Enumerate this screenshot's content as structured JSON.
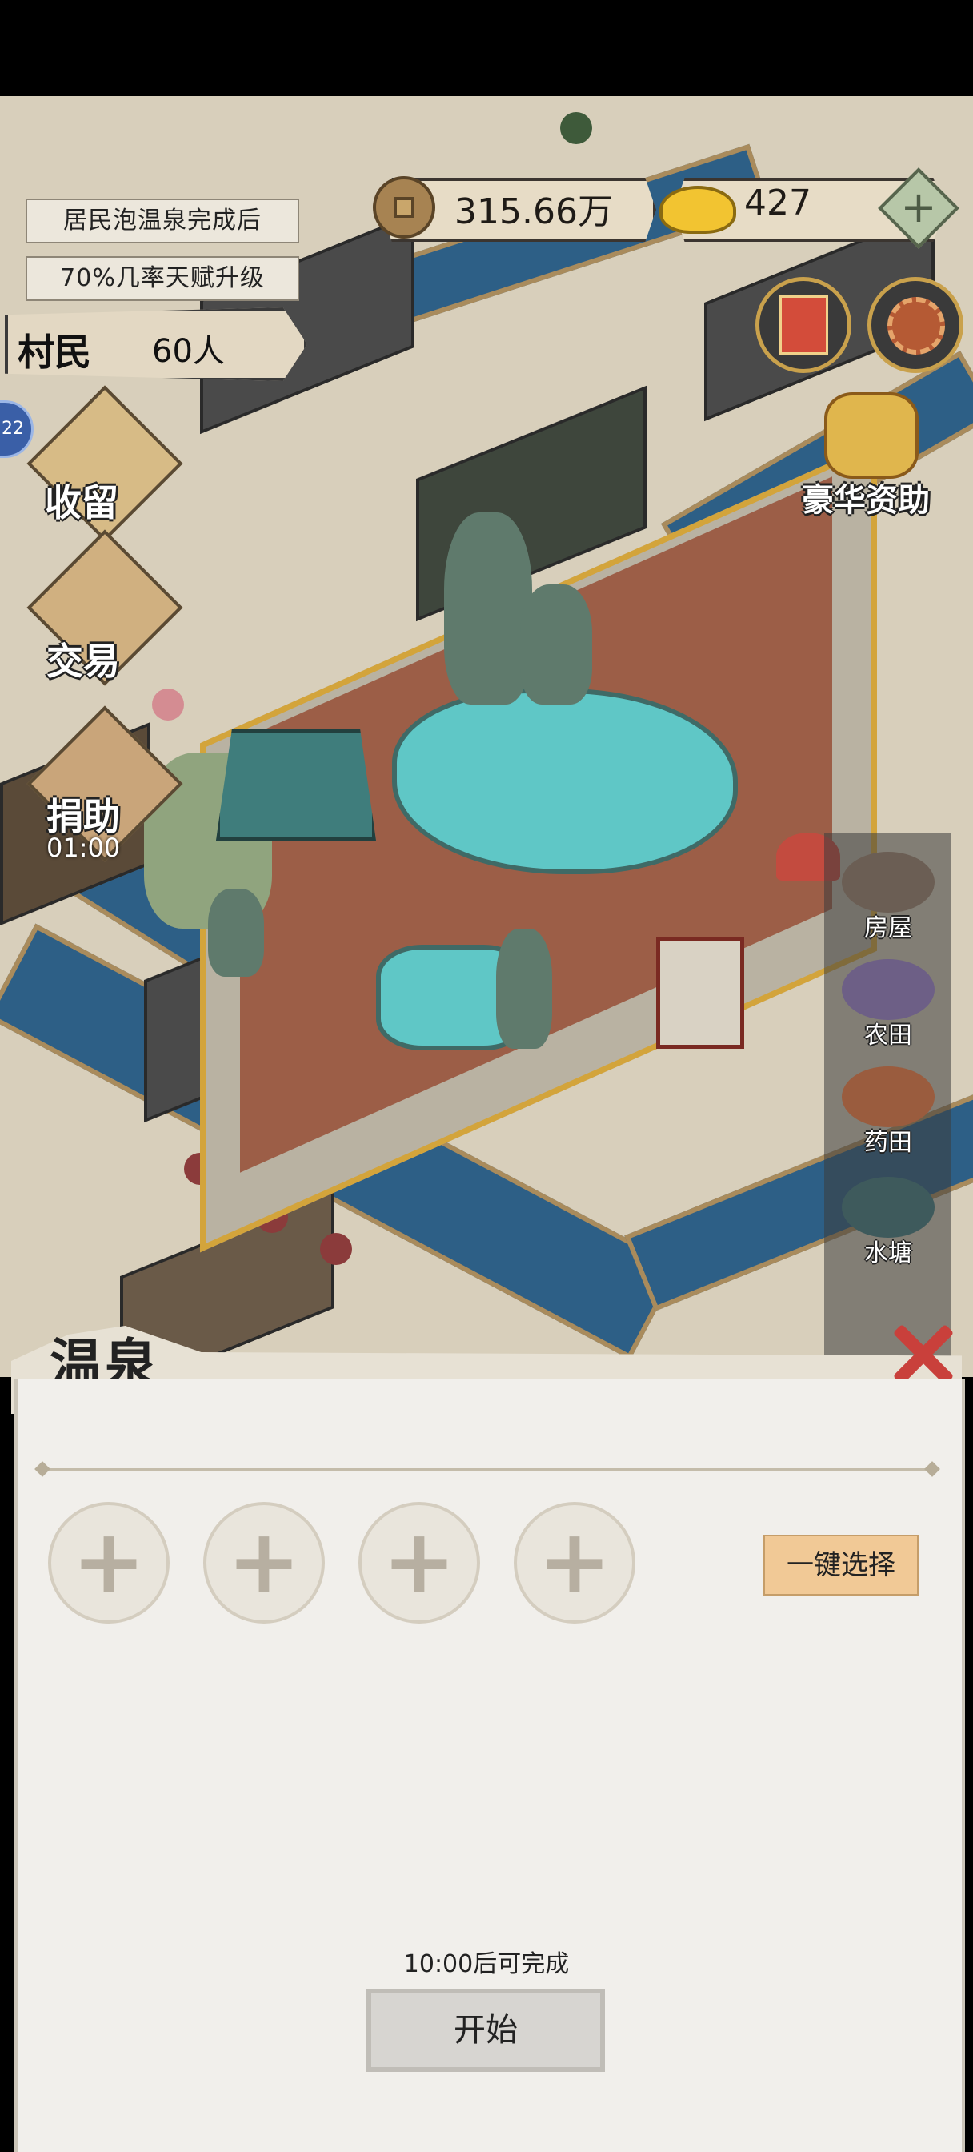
{
  "hud": {
    "notice_line1": "居民泡温泉完成后",
    "notice_line2": "70%几率天赋升级",
    "villager_label": "村民",
    "villager_count": "60人",
    "copper_coins": "315.66万",
    "gold_ingots": "427",
    "add_symbol": "+",
    "badge_number": "22"
  },
  "side_menu": {
    "shelter_label": "收留",
    "trade_label": "交易",
    "donate_label": "捐助",
    "donate_timer": "01:00"
  },
  "luxury": {
    "label": "豪华资助"
  },
  "build_menu": {
    "items": [
      {
        "label": "房屋",
        "icon": "house-icon"
      },
      {
        "label": "农田",
        "icon": "farmland-icon"
      },
      {
        "label": "药田",
        "icon": "herb-field-icon"
      },
      {
        "label": "水塘",
        "icon": "pond-icon"
      }
    ]
  },
  "panel": {
    "title": "温泉",
    "slot_symbol": "+",
    "one_key_label": "一键选择",
    "finish_text": "10:00后可完成",
    "start_label": "开始"
  },
  "colors": {
    "river": "#2d5f86",
    "pool": "#5fc7c6",
    "close_red": "#c9403b",
    "button_peach": "#f1c996"
  }
}
